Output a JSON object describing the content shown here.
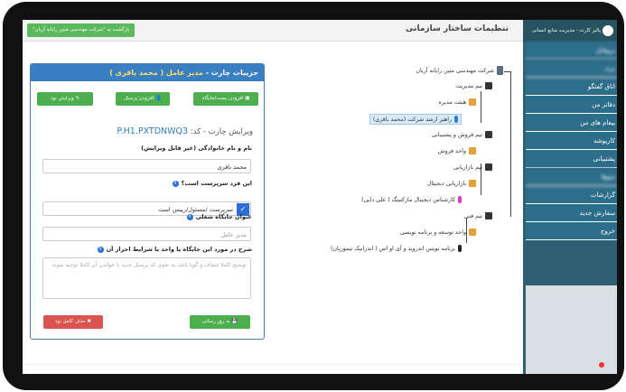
{
  "header": {
    "page_title": "تنظیمات ساختار سازمانی",
    "back_label": "بازگشت به \"شرکت مهندسی متین رایانه آریان\""
  },
  "sidebar": {
    "brand": "پالیز کارت - مدیریت منابع انسانی",
    "items": [
      {
        "label": "پروفایل",
        "blurred": true
      },
      {
        "label": "تردد",
        "blurred": true
      },
      {
        "label": "اتاق گفتگو",
        "blurred": false
      },
      {
        "label": "دفاتر من",
        "blurred": false
      },
      {
        "label": "پیغام های من",
        "blurred": false
      },
      {
        "label": "کارپوشه",
        "blurred": false
      },
      {
        "label": "پشتیبانی",
        "blurred": false
      },
      {
        "label": "منوها",
        "blurred": true
      },
      {
        "label": "گزارشات",
        "blurred": false
      },
      {
        "label": "سفارش جدید",
        "blurred": false
      },
      {
        "label": "خروج",
        "blurred": false
      }
    ]
  },
  "panel": {
    "title_prefix": "جزییات چارت - ",
    "title_highlight": "مدیر عامل ( محمد باقری )",
    "buttons": {
      "add_position": "افزودن پست/جایگاه",
      "add_personnel": "افزودن پرسنل",
      "edit_node": "ویرایش نود"
    },
    "edit_label": "ویرایش چارت - کد:",
    "code": "P.H1.PXTDNWQ3",
    "name_label": "نام و نام خانوادگی (غیر قابل ویرایش)",
    "name_value": "محمد باقری",
    "supervisor_question": "این فرد سرپرست است؟",
    "supervisor_option": "سرپرست /مسئول/رییس است",
    "job_title_label": "عنوان جایگاه شغلی",
    "job_title_value": "مدیر عامل",
    "desc_label": "شرح در مورد این جایگاه یا واحد یا شرایط احراز آن",
    "desc_placeholder": "توضیح کاملا شفاف و گویا باشد به نحوی که پرسنل جدید با خواندن آن کاملا توجیه شوند",
    "update_label": "به روز رسانی",
    "delete_label": "حذف کامل نود"
  },
  "tree": {
    "root": "شرکت مهندسی متین رایانه آریان",
    "nodes": [
      "تیم مدیریت",
      "هیئت مدیره",
      "راهبر ارشد شرکت (محمد باقری)",
      "تیم فروش و پشتیبانی",
      "واحد فروش",
      "تیم بازاریابی",
      "بازاریابی دیجیتال",
      "کارشناس دیجیتال مارکتینگ ( علی دایی)",
      "تیم فنی",
      "واحد توسعه و برنامه نویسی",
      "برنامه نویس اندروید و آی او اس ( اندرانیک تیموریان)"
    ]
  }
}
